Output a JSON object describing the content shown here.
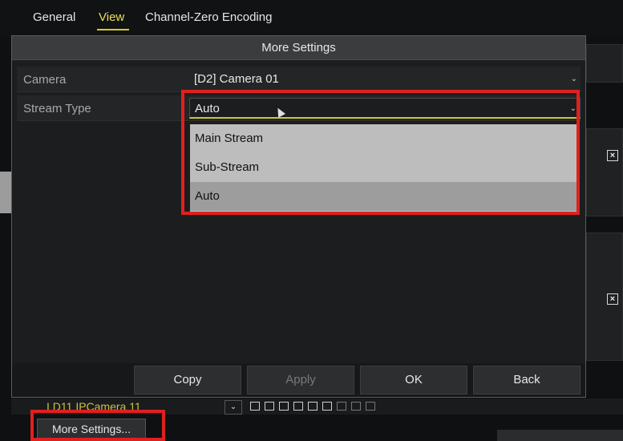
{
  "top_tabs": [
    {
      "label": "General"
    },
    {
      "label": "View"
    },
    {
      "label": "Channel-Zero Encoding"
    }
  ],
  "dialog": {
    "title": "More Settings",
    "camera_label": "Camera",
    "camera_value": "[D2] Camera 01",
    "stream_type_label": "Stream Type",
    "stream_type_value": "Auto",
    "stream_type_options": [
      "Main Stream",
      "Sub-Stream",
      "Auto"
    ],
    "selected_option": "Auto",
    "buttons": {
      "copy": "Copy",
      "apply": "Apply",
      "ok": "OK",
      "back": "Back"
    }
  },
  "background": {
    "row_text": "I D11 IPCamera 11",
    "more_settings_button": "More Settings..."
  },
  "colors": {
    "highlight": "#e0201e",
    "active_tab": "#e8e05a",
    "dropdown_bg": "#bdbdbd",
    "dropdown_selected": "#9d9d9d"
  }
}
